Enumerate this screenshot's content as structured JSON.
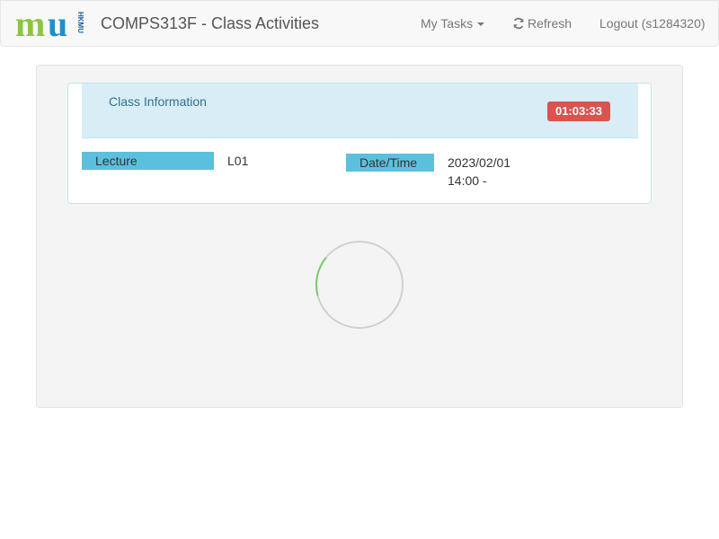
{
  "header": {
    "logo_letters": "mu",
    "logo_side_text": "HKMU",
    "title": "COMPS313F - Class Activities",
    "nav": {
      "my_tasks": "My Tasks",
      "refresh": "Refresh",
      "logout": "Logout (s1284320)"
    }
  },
  "panel": {
    "title": "Class Information",
    "timer": "01:03:33",
    "lecture_label": "Lecture",
    "lecture_value": "L01",
    "datetime_label": "Date/Time",
    "date_value": "2023/02/01",
    "time_value": "14:00 -"
  },
  "loading": {
    "progress_fraction": 0.15
  },
  "colors": {
    "logo_green": "#8cc63f",
    "logo_blue": "#1d8fcf",
    "panel_heading_bg": "#d9edf7",
    "label_bg": "#5bc0de",
    "timer_bg": "#d9534f",
    "spinner_track": "#d0d0d0",
    "spinner_progress": "#7bc96f"
  },
  "icons": {
    "caret": "caret-down-icon",
    "refresh": "refresh-icon",
    "spinner": "loading-spinner"
  }
}
